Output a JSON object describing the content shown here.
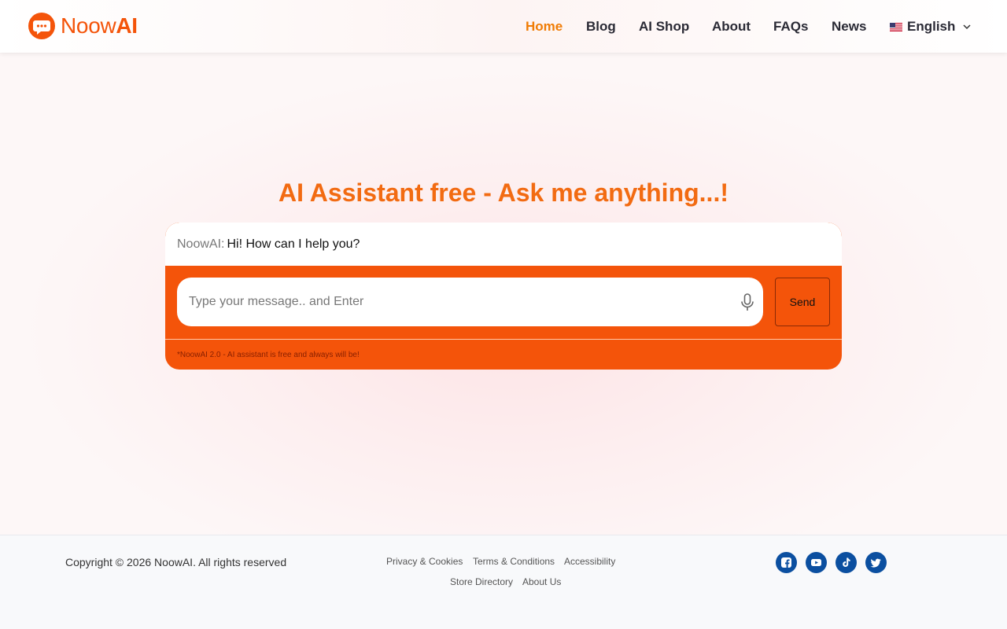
{
  "brand": {
    "name_regular": "Noow",
    "name_bold": "AI",
    "color": "#f4540a"
  },
  "nav": {
    "items": [
      {
        "label": "Home",
        "active": true
      },
      {
        "label": "Blog"
      },
      {
        "label": "AI Shop"
      },
      {
        "label": "About"
      },
      {
        "label": "FAQs"
      },
      {
        "label": "News"
      }
    ],
    "language": {
      "label": "English",
      "icon": "us-flag-icon"
    }
  },
  "hero": {
    "headline": "AI Assistant free - Ask me anything...!"
  },
  "chat": {
    "bot_name": "NoowAI:",
    "bot_message": "Hi! How can I help you?",
    "input_placeholder": "Type your message.. and Enter",
    "input_value": "",
    "send_label": "Send",
    "note": "*NoowAI 2.0 - AI assistant is free and always will be!",
    "accent_color": "#f4540a"
  },
  "footer": {
    "copyright": "Copyright © 2026 NoowAI. All rights reserved",
    "links": [
      "Privacy & Cookies",
      "Terms & Conditions",
      "Accessibility",
      "Store Directory",
      "About Us"
    ],
    "social": [
      "facebook-icon",
      "youtube-icon",
      "tiktok-icon",
      "twitter-icon"
    ],
    "social_color": "#0b4fa0"
  }
}
